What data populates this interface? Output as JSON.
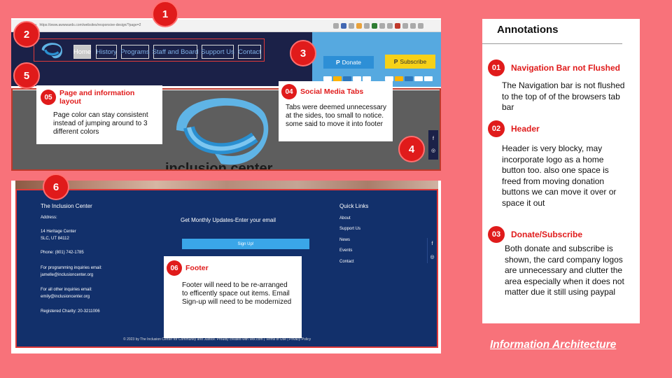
{
  "browser": {
    "url_prefix": "ecure",
    "url": "https://www.awwwards.com/websites/responsive-design/?page=2"
  },
  "nav": {
    "items": [
      "Home",
      "History",
      "Programs",
      "Staff and Board",
      "Support Us",
      "Contact"
    ],
    "active": "Home"
  },
  "donate": {
    "donate_label": "Donate",
    "subscribe_label": "Subscribe",
    "paypal_glyph": "P"
  },
  "hero": {
    "title": "inclusion center"
  },
  "social": {
    "facebook_glyph": "f",
    "instagram_glyph": "◎"
  },
  "footer": {
    "org_name": "The Inclusion Center",
    "address_label": "Address:",
    "address_line1": "14 Heritage Center",
    "address_line2": "SLC, UT 84112",
    "phone": "Phone:  (801) 742-1785",
    "programming_label": "For programming inquiries email:",
    "programming_email": "jamelle@inclusioncenter.org",
    "other_label": "For all other inquiries email:",
    "other_email": "emily@inclusioncenter.org",
    "charity": "Registered Charity: 20-3211006",
    "signup_prompt": "Get Monthly Updates-Enter your email",
    "signup_button": "Sign Up!",
    "quick_links_title": "Quick Links",
    "quick_links": [
      "About",
      "Support Us",
      "News",
      "Events",
      "Contact"
    ],
    "legal": "© 2023 by The Inclusion Center for Community and Justice. Proudly created with Wix.com  |  Terms of Use  |  Privacy Policy"
  },
  "badges": [
    "1",
    "2",
    "3",
    "4",
    "5",
    "6"
  ],
  "overlay_cards": {
    "c05": {
      "num": "05",
      "title": "Page and information layout",
      "body": "Page color can stay consistent instead of jumping around to 3 different colors"
    },
    "c04": {
      "num": "04",
      "title": "Social Media Tabs",
      "body": "Tabs were deemed unnecessary at the sides, too small to notice. some said to move it into footer"
    },
    "c06": {
      "num": "06",
      "title": "Footer",
      "body": "Footer will need to be re-arranged to efficently space out items. Email Sign-up will need to be modernized"
    }
  },
  "panel": {
    "title": "Annotations",
    "items": [
      {
        "num": "01",
        "title": "Navigation Bar not Flushed",
        "body": "The Navigation bar is not flushed to the top of of the browsers tab bar"
      },
      {
        "num": "02",
        "title": "Header",
        "body": "Header is very blocky, may incorporate logo as a home button too. also one space is freed from moving donation buttons we can move it over or space it out"
      },
      {
        "num": "03",
        "title": "Donate/Subscribe",
        "body": "Both donate and subscribe is shown, the card company logos are unnecessary and clutter the area especially when it does not matter due it still using paypal"
      }
    ]
  },
  "caption": "Information Architecture",
  "colors": {
    "background": "#f8727a",
    "accent_red": "#e01b1b",
    "header_navy": "#1b2148",
    "footer_navy": "#12306b",
    "donate_blue": "#2d8fd6",
    "subscribe_yellow": "#f7d117"
  }
}
